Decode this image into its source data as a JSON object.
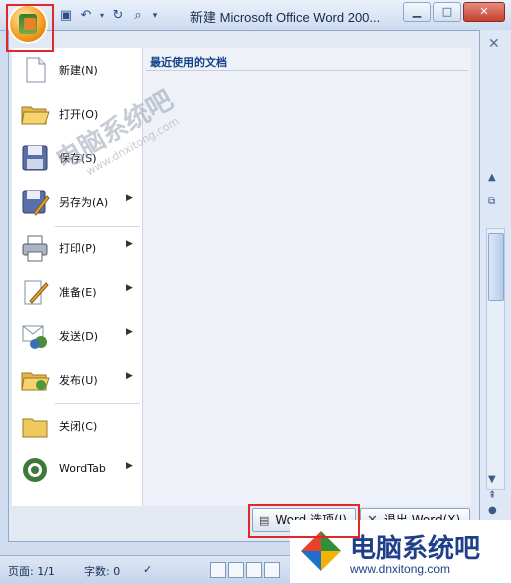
{
  "window": {
    "title": "新建 Microsoft Office Word 200...",
    "colors": {
      "highlight_outline": "#e0272a",
      "accent": "#15428b"
    }
  },
  "quick_access": {
    "icons": [
      "word-icon",
      "save-icon",
      "undo-icon",
      "redo-icon",
      "print-preview-icon",
      "customize-dropdown-icon"
    ]
  },
  "office_menu": {
    "recent_header": "最近使用的文档",
    "items": [
      {
        "label": "新建(N)",
        "icon": "new-document-icon",
        "submenu": false
      },
      {
        "label": "打开(O)",
        "icon": "open-folder-icon",
        "submenu": false
      },
      {
        "label": "保存(S)",
        "icon": "save-disk-icon",
        "submenu": false
      },
      {
        "label": "另存为(A)",
        "icon": "save-as-icon",
        "submenu": true
      },
      {
        "label": "打印(P)",
        "icon": "printer-icon",
        "submenu": true
      },
      {
        "label": "准备(E)",
        "icon": "prepare-icon",
        "submenu": true
      },
      {
        "label": "发送(D)",
        "icon": "send-icon",
        "submenu": true
      },
      {
        "label": "发布(U)",
        "icon": "publish-icon",
        "submenu": true
      },
      {
        "label": "关闭(C)",
        "icon": "close-folder-icon",
        "submenu": false
      },
      {
        "label": "WordTab",
        "icon": "wordtab-icon",
        "submenu": true
      }
    ],
    "word_options_button": "Word 选项(I)",
    "exit_word_button": "退出 Word(X)"
  },
  "status_bar": {
    "page": "页面: 1/1",
    "word_count": "字数: 0"
  },
  "watermarks": {
    "overlay_text": "电脑系统吧",
    "overlay_url": "www.dnxitong.com",
    "corner_text": "电脑系统吧",
    "corner_url": "www.dnxitong.com"
  }
}
